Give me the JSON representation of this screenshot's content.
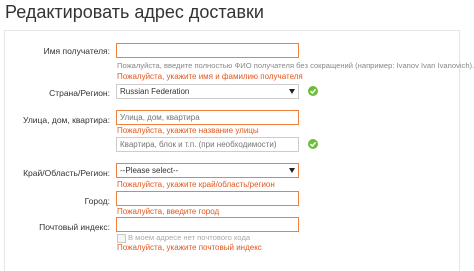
{
  "page_title": "Редактировать адрес доставки",
  "recipient": {
    "label": "Имя получателя:",
    "value": "",
    "hint": "Пожалуйста, введите полностью ФИО получателя без сокращений (например: Ivanov Ivan Ivanovich).",
    "error": "Пожалуйста, укажите имя и фамилию получателя"
  },
  "country": {
    "label": "Страна/Регион:",
    "selected": "Russian Federation"
  },
  "street": {
    "label": "Улица, дом, квартира:",
    "placeholder": "Улица, дом, квартира",
    "error": "Пожалуйста, укажите название улицы",
    "extra_placeholder": "Квартира, блок и т.п. (при необходимости)"
  },
  "region": {
    "label": "Край/Область/Регион:",
    "selected": "--Please select--",
    "error": "Пожалуйста, укажите край/область/регион"
  },
  "city": {
    "label": "Город:",
    "value": "",
    "error": "Пожалуйста, введите город"
  },
  "postal": {
    "label": "Почтовый индекс:",
    "value": "",
    "no_code_label": "В моем адресе нет почтового кода",
    "error": "Пожалуйста, укажите почтовый индекс"
  },
  "colors": {
    "error_text": "#e2571d",
    "error_border": "#f08040",
    "valid_check": "#6abf3a"
  },
  "icons": {
    "country_check": "check-circle-icon",
    "street_check": "check-circle-icon",
    "select_arrow": "triangle-down-icon"
  }
}
